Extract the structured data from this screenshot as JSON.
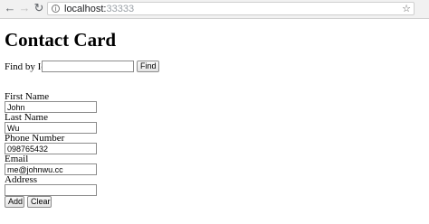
{
  "browser": {
    "url_host": "localhost:",
    "url_port": "33333",
    "back_icon": "←",
    "forward_icon": "→",
    "reload_icon": "↻",
    "info_icon": "i",
    "bookmark_icon": "☆"
  },
  "page": {
    "title": "Contact Card",
    "find": {
      "label": "Find by Id",
      "value": "",
      "button": "Find"
    },
    "form": {
      "first_name_label": "First Name",
      "first_name_value": "John",
      "last_name_label": "Last Name",
      "last_name_value": "Wu",
      "phone_label": "Phone Number",
      "phone_value": "098765432",
      "email_label": "Email",
      "email_value": "me@johnwu.cc",
      "address_label": "Address",
      "address_value": ""
    },
    "add_button": "Add",
    "clear_button": "Clear"
  }
}
